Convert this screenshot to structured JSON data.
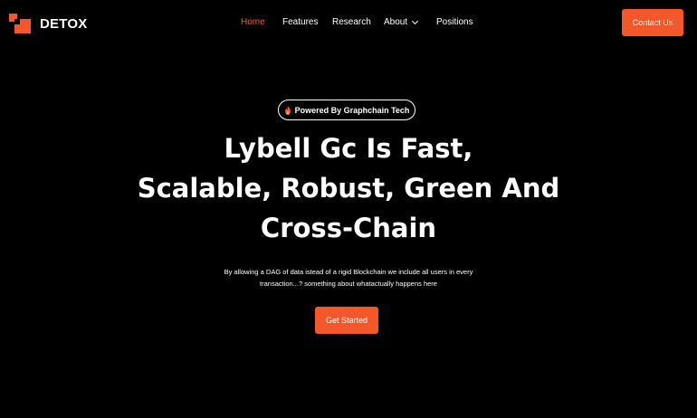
{
  "brand": {
    "name": "DETOX",
    "accent_color": "#f4582a",
    "background_color": "#000000",
    "logo_icon": "square-blocks-logo-icon"
  },
  "nav": {
    "items": [
      {
        "label": "Home",
        "active": true
      },
      {
        "label": "Features",
        "active": false
      },
      {
        "label": "Research",
        "active": false
      },
      {
        "label": "About",
        "active": false,
        "dropdown": true,
        "icon": "chevron-down-icon"
      },
      {
        "label": "Positions",
        "active": false
      }
    ]
  },
  "header": {
    "contact_label": "Contact Us"
  },
  "hero": {
    "badge_icon": "flame-icon",
    "badge_text": "Powered By Graphchain Tech",
    "title_lines": [
      "Lybell Gc Is Fast,",
      "Scalable, Robust, Green And",
      "Cross-Chain"
    ],
    "description_lines": [
      "By allowing a DAG of data istead of a rigid Blockchain we include all users in every",
      "transaction...? something about whatactually happens here"
    ],
    "cta_label": "Get Started"
  }
}
